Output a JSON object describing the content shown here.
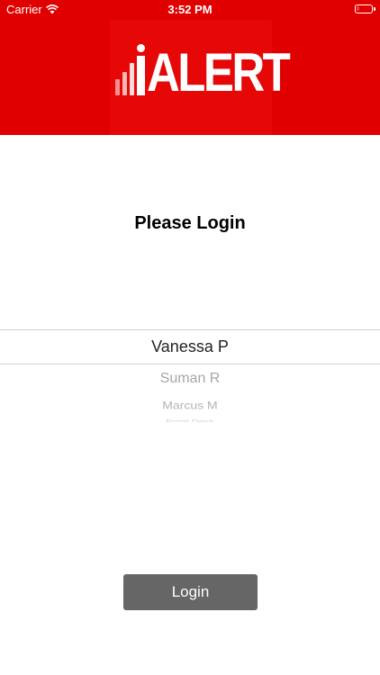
{
  "status_bar": {
    "carrier": "Carrier",
    "time": "3:52 PM",
    "battery_level": 0.2
  },
  "header": {
    "logo_text": "iALERT",
    "logo_text_rest": "ALERT",
    "background_color": "#e00000"
  },
  "main": {
    "title": "Please Login"
  },
  "user_picker": {
    "selected": "Vanessa P",
    "options": [
      "Vanessa P",
      "Suman R",
      "Marcus M",
      "Front Desk"
    ]
  },
  "login_button": {
    "label": "Login",
    "color": "#666666"
  }
}
